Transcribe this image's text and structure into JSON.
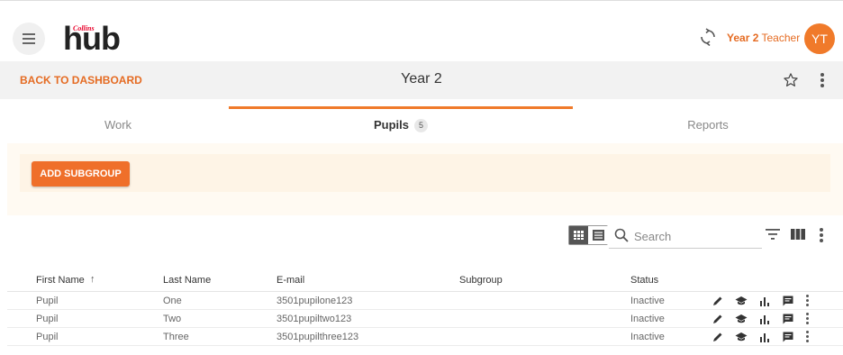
{
  "brand": {
    "logo_small": "Collins",
    "logo_main": "hub"
  },
  "user": {
    "class": "Year 2",
    "role": "Teacher",
    "initials": "YT"
  },
  "nav": {
    "back_label": "BACK TO DASHBOARD",
    "page_title": "Year 2"
  },
  "tabs": [
    {
      "label": "Work"
    },
    {
      "label": "Pupils",
      "count": "5"
    },
    {
      "label": "Reports"
    }
  ],
  "actions": {
    "add_subgroup": "ADD SUBGROUP"
  },
  "search": {
    "placeholder": "Search"
  },
  "table": {
    "headers": [
      "First Name",
      "Last Name",
      "E-mail",
      "Subgroup",
      "Status"
    ],
    "sort_indicator": "↑",
    "rows": [
      {
        "first": "Pupil",
        "last": "One",
        "email": "3501pupilone123",
        "subgroup": "",
        "status": "Inactive"
      },
      {
        "first": "Pupil",
        "last": "Two",
        "email": "3501pupiltwo123",
        "subgroup": "",
        "status": "Inactive"
      },
      {
        "first": "Pupil",
        "last": "Three",
        "email": "3501pupilthree123",
        "subgroup": "",
        "status": "Inactive"
      }
    ]
  },
  "row_action_icons": [
    "edit-icon",
    "graduation-cap-icon",
    "bar-chart-icon",
    "message-icon",
    "more-vert-icon"
  ],
  "colors": {
    "accent": "#ef6f2a",
    "avatar": "#f07a2a",
    "subbar": "#f2f2f2",
    "cream": "#fffaf2"
  }
}
